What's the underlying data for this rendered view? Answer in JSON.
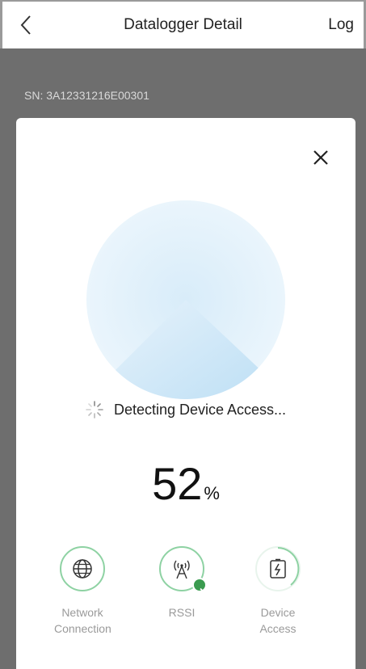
{
  "navbar": {
    "title": "Datalogger Detail",
    "right_label": "Log",
    "back_icon": "chevron-left-icon"
  },
  "underlay": {
    "serial": "SN:  3A12331216E00301"
  },
  "modal": {
    "close_icon": "close-icon",
    "status_text": "Detecting Device Access...",
    "progress_value": "52",
    "progress_unit": "%",
    "progress_fraction": 0.52,
    "steps": [
      {
        "label_line1": "Network",
        "label_line2": "Connection",
        "icon": "globe-icon",
        "state": "complete"
      },
      {
        "label_line1": "RSSI",
        "label_line2": "",
        "icon": "antenna-icon",
        "state": "complete-check"
      },
      {
        "label_line1": "Device",
        "label_line2": "Access",
        "icon": "device-charge-icon",
        "state": "in-progress"
      }
    ],
    "colors": {
      "accent_green": "#3a9b4f",
      "ring_green": "#8ed2a3",
      "pie_blue": "#bfe0f5"
    }
  }
}
